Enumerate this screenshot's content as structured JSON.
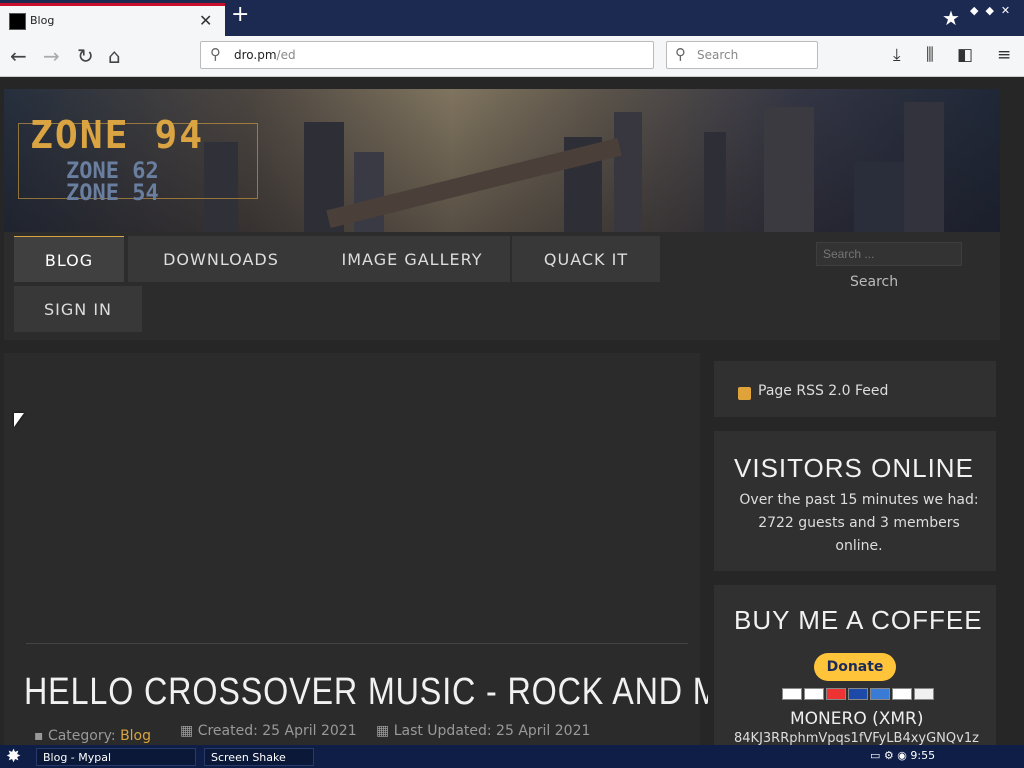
{
  "browser": {
    "tab_title": "Blog",
    "new_tab_icon": "plus-icon",
    "url_host": "dro.pm",
    "url_path": "/ed",
    "search_placeholder": "Search"
  },
  "site": {
    "logo_main": "ZONE 94",
    "logo_sub1": "ZONE 62",
    "logo_sub2": "ZONE 54",
    "menu": {
      "blog": "BLOG",
      "downloads": "DOWNLOADS",
      "gallery": "IMAGE GALLERY",
      "quack": "QUACK IT",
      "signin": "SIGN IN"
    },
    "search_placeholder": "Search ...",
    "search_button": "Search"
  },
  "article": {
    "title": "HELLO CROSSOVER MUSIC - ROCK AND METAL",
    "category_label": "Category:",
    "category_value": "Blog",
    "created": "Created: 25 April 2021",
    "updated": "Last Updated: 25 April 2021"
  },
  "sidebar": {
    "rss_text": "Page RSS 2.0 Feed",
    "visitors_title": "VISITORS ONLINE",
    "visitors_text": "Over the past 15 minutes we had: 2722 guests and 3 members online.",
    "coffee_title": "BUY ME A COFFEE",
    "donate_label": "Donate",
    "xmr_label": "MONERO (XMR)",
    "xmr_address": "84KJ3RRphmVpqs1fVFyLB4xyGNQv1z"
  },
  "taskbar": {
    "task1": "Blog - Mypal",
    "task2": "Screen Shake",
    "clock": "9:55"
  },
  "colors": {
    "accent": "#d9a441",
    "tab_red": "#c8102e",
    "taskbar": "#0e1e46"
  }
}
